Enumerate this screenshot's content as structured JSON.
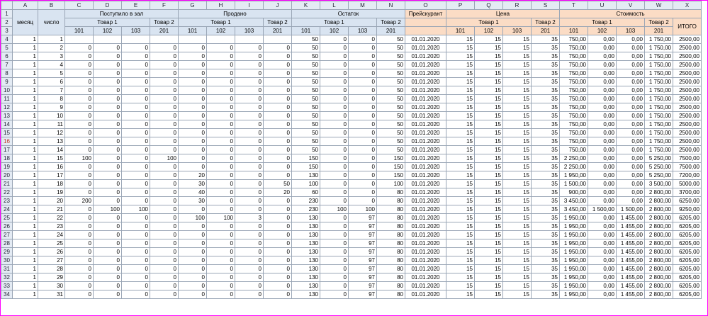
{
  "columns": [
    "A",
    "B",
    "C",
    "D",
    "E",
    "F",
    "G",
    "H",
    "I",
    "J",
    "K",
    "L",
    "M",
    "N",
    "O",
    "P",
    "Q",
    "R",
    "S",
    "T",
    "U",
    "V",
    "W",
    "X"
  ],
  "header": {
    "mesyac": "месяц",
    "chislo": "число",
    "postupilo": "Поступило в зал",
    "prodano": "Продано",
    "ostatok": "Остаток",
    "preyskurant": "Прейскурант",
    "cena": "Цена",
    "stoimost": "Стоимость",
    "tovar1": "Товар 1",
    "tovar2": "Товар 2",
    "c101": "101",
    "c102": "102",
    "c103": "103",
    "c201": "201",
    "itogo": "ИТОГО"
  },
  "selected_row_header": "16",
  "rows": [
    {
      "n": "4",
      "a": "1",
      "b": "1",
      "k": "50",
      "l": "0",
      "m": "0",
      "nn": "50",
      "o": "01.01.2020",
      "p": "15",
      "q": "15",
      "r": "15",
      "s": "35",
      "t": "750,00",
      "u": "0,00",
      "v": "0,00",
      "w": "1 750,00",
      "x": "2500,00"
    },
    {
      "n": "5",
      "a": "1",
      "b": "2",
      "c": "0",
      "d": "0",
      "e": "0",
      "f": "0",
      "g": "0",
      "h": "0",
      "i": "0",
      "j": "0",
      "k": "50",
      "l": "0",
      "m": "0",
      "nn": "50",
      "o": "01.01.2020",
      "p": "15",
      "q": "15",
      "r": "15",
      "s": "35",
      "t": "750,00",
      "u": "0,00",
      "v": "0,00",
      "w": "1 750,00",
      "x": "2500,00"
    },
    {
      "n": "6",
      "a": "1",
      "b": "3",
      "c": "0",
      "d": "0",
      "e": "0",
      "f": "0",
      "g": "0",
      "h": "0",
      "i": "0",
      "j": "0",
      "k": "50",
      "l": "0",
      "m": "0",
      "nn": "50",
      "o": "01.01.2020",
      "p": "15",
      "q": "15",
      "r": "15",
      "s": "35",
      "t": "750,00",
      "u": "0,00",
      "v": "0,00",
      "w": "1 750,00",
      "x": "2500,00"
    },
    {
      "n": "7",
      "a": "1",
      "b": "4",
      "c": "0",
      "d": "0",
      "e": "0",
      "f": "0",
      "g": "0",
      "h": "0",
      "i": "0",
      "j": "0",
      "k": "50",
      "l": "0",
      "m": "0",
      "nn": "50",
      "o": "01.01.2020",
      "p": "15",
      "q": "15",
      "r": "15",
      "s": "35",
      "t": "750,00",
      "u": "0,00",
      "v": "0,00",
      "w": "1 750,00",
      "x": "2500,00"
    },
    {
      "n": "8",
      "a": "1",
      "b": "5",
      "c": "0",
      "d": "0",
      "e": "0",
      "f": "0",
      "g": "0",
      "h": "0",
      "i": "0",
      "j": "0",
      "k": "50",
      "l": "0",
      "m": "0",
      "nn": "50",
      "o": "01.01.2020",
      "p": "15",
      "q": "15",
      "r": "15",
      "s": "35",
      "t": "750,00",
      "u": "0,00",
      "v": "0,00",
      "w": "1 750,00",
      "x": "2500,00"
    },
    {
      "n": "9",
      "a": "1",
      "b": "6",
      "c": "0",
      "d": "0",
      "e": "0",
      "f": "0",
      "g": "0",
      "h": "0",
      "i": "0",
      "j": "0",
      "k": "50",
      "l": "0",
      "m": "0",
      "nn": "50",
      "o": "01.01.2020",
      "p": "15",
      "q": "15",
      "r": "15",
      "s": "35",
      "t": "750,00",
      "u": "0,00",
      "v": "0,00",
      "w": "1 750,00",
      "x": "2500,00"
    },
    {
      "n": "10",
      "a": "1",
      "b": "7",
      "c": "0",
      "d": "0",
      "e": "0",
      "f": "0",
      "g": "0",
      "h": "0",
      "i": "0",
      "j": "0",
      "k": "50",
      "l": "0",
      "m": "0",
      "nn": "50",
      "o": "01.01.2020",
      "p": "15",
      "q": "15",
      "r": "15",
      "s": "35",
      "t": "750,00",
      "u": "0,00",
      "v": "0,00",
      "w": "1 750,00",
      "x": "2500,00"
    },
    {
      "n": "11",
      "a": "1",
      "b": "8",
      "c": "0",
      "d": "0",
      "e": "0",
      "f": "0",
      "g": "0",
      "h": "0",
      "i": "0",
      "j": "0",
      "k": "50",
      "l": "0",
      "m": "0",
      "nn": "50",
      "o": "01.01.2020",
      "p": "15",
      "q": "15",
      "r": "15",
      "s": "35",
      "t": "750,00",
      "u": "0,00",
      "v": "0,00",
      "w": "1 750,00",
      "x": "2500,00"
    },
    {
      "n": "12",
      "a": "1",
      "b": "9",
      "c": "0",
      "d": "0",
      "e": "0",
      "f": "0",
      "g": "0",
      "h": "0",
      "i": "0",
      "j": "0",
      "k": "50",
      "l": "0",
      "m": "0",
      "nn": "50",
      "o": "01.01.2020",
      "p": "15",
      "q": "15",
      "r": "15",
      "s": "35",
      "t": "750,00",
      "u": "0,00",
      "v": "0,00",
      "w": "1 750,00",
      "x": "2500,00"
    },
    {
      "n": "13",
      "a": "1",
      "b": "10",
      "c": "0",
      "d": "0",
      "e": "0",
      "f": "0",
      "g": "0",
      "h": "0",
      "i": "0",
      "j": "0",
      "k": "50",
      "l": "0",
      "m": "0",
      "nn": "50",
      "o": "01.01.2020",
      "p": "15",
      "q": "15",
      "r": "15",
      "s": "35",
      "t": "750,00",
      "u": "0,00",
      "v": "0,00",
      "w": "1 750,00",
      "x": "2500,00"
    },
    {
      "n": "14",
      "a": "1",
      "b": "11",
      "c": "0",
      "d": "0",
      "e": "0",
      "f": "0",
      "g": "0",
      "h": "0",
      "i": "0",
      "j": "0",
      "k": "50",
      "l": "0",
      "m": "0",
      "nn": "50",
      "o": "01.01.2020",
      "p": "15",
      "q": "15",
      "r": "15",
      "s": "35",
      "t": "750,00",
      "u": "0,00",
      "v": "0,00",
      "w": "1 750,00",
      "x": "2500,00"
    },
    {
      "n": "15",
      "a": "1",
      "b": "12",
      "c": "0",
      "d": "0",
      "e": "0",
      "f": "0",
      "g": "0",
      "h": "0",
      "i": "0",
      "j": "0",
      "k": "50",
      "l": "0",
      "m": "0",
      "nn": "50",
      "o": "01.01.2020",
      "p": "15",
      "q": "15",
      "r": "15",
      "s": "35",
      "t": "750,00",
      "u": "0,00",
      "v": "0,00",
      "w": "1 750,00",
      "x": "2500,00"
    },
    {
      "n": "16",
      "a": "1",
      "b": "13",
      "c": "0",
      "d": "0",
      "e": "0",
      "f": "0",
      "g": "0",
      "h": "0",
      "i": "0",
      "j": "0",
      "k": "50",
      "l": "0",
      "m": "0",
      "nn": "50",
      "o": "01.01.2020",
      "p": "15",
      "q": "15",
      "r": "15",
      "s": "35",
      "t": "750,00",
      "u": "0,00",
      "v": "0,00",
      "w": "1 750,00",
      "x": "2500,00"
    },
    {
      "n": "17",
      "a": "1",
      "b": "14",
      "c": "0",
      "d": "0",
      "e": "0",
      "f": "0",
      "g": "0",
      "h": "0",
      "i": "0",
      "j": "0",
      "k": "50",
      "l": "0",
      "m": "0",
      "nn": "50",
      "o": "01.01.2020",
      "p": "15",
      "q": "15",
      "r": "15",
      "s": "35",
      "t": "750,00",
      "u": "0,00",
      "v": "0,00",
      "w": "1 750,00",
      "x": "2500,00"
    },
    {
      "n": "18",
      "a": "1",
      "b": "15",
      "c": "100",
      "d": "0",
      "e": "0",
      "f": "100",
      "g": "0",
      "h": "0",
      "i": "0",
      "j": "0",
      "k": "150",
      "l": "0",
      "m": "0",
      "nn": "150",
      "o": "01.01.2020",
      "p": "15",
      "q": "15",
      "r": "15",
      "s": "35",
      "t": "2 250,00",
      "u": "0,00",
      "v": "0,00",
      "w": "5 250,00",
      "x": "7500,00"
    },
    {
      "n": "19",
      "a": "1",
      "b": "16",
      "c": "0",
      "d": "0",
      "e": "0",
      "f": "0",
      "g": "0",
      "h": "0",
      "i": "0",
      "j": "0",
      "k": "150",
      "l": "0",
      "m": "0",
      "nn": "150",
      "o": "01.01.2020",
      "p": "15",
      "q": "15",
      "r": "15",
      "s": "35",
      "t": "2 250,00",
      "u": "0,00",
      "v": "0,00",
      "w": "5 250,00",
      "x": "7500,00"
    },
    {
      "n": "20",
      "a": "1",
      "b": "17",
      "c": "0",
      "d": "0",
      "e": "0",
      "f": "0",
      "g": "20",
      "h": "0",
      "i": "0",
      "j": "0",
      "k": "130",
      "l": "0",
      "m": "0",
      "nn": "150",
      "o": "01.01.2020",
      "p": "15",
      "q": "15",
      "r": "15",
      "s": "35",
      "t": "1 950,00",
      "u": "0,00",
      "v": "0,00",
      "w": "5 250,00",
      "x": "7200,00"
    },
    {
      "n": "21",
      "a": "1",
      "b": "18",
      "c": "0",
      "d": "0",
      "e": "0",
      "f": "0",
      "g": "30",
      "h": "0",
      "i": "0",
      "j": "50",
      "k": "100",
      "l": "0",
      "m": "0",
      "nn": "100",
      "o": "01.01.2020",
      "p": "15",
      "q": "15",
      "r": "15",
      "s": "35",
      "t": "1 500,00",
      "u": "0,00",
      "v": "0,00",
      "w": "3 500,00",
      "x": "5000,00"
    },
    {
      "n": "22",
      "a": "1",
      "b": "19",
      "c": "0",
      "d": "0",
      "e": "0",
      "f": "0",
      "g": "40",
      "h": "0",
      "i": "0",
      "j": "20",
      "k": "60",
      "l": "0",
      "m": "0",
      "nn": "80",
      "o": "01.01.2020",
      "p": "15",
      "q": "15",
      "r": "15",
      "s": "35",
      "t": "900,00",
      "u": "0,00",
      "v": "0,00",
      "w": "2 800,00",
      "x": "3700,00"
    },
    {
      "n": "23",
      "a": "1",
      "b": "20",
      "c": "200",
      "d": "0",
      "e": "0",
      "f": "0",
      "g": "30",
      "h": "0",
      "i": "0",
      "j": "0",
      "k": "230",
      "l": "0",
      "m": "0",
      "nn": "80",
      "o": "01.01.2020",
      "p": "15",
      "q": "15",
      "r": "15",
      "s": "35",
      "t": "3 450,00",
      "u": "0,00",
      "v": "0,00",
      "w": "2 800,00",
      "x": "6250,00"
    },
    {
      "n": "24",
      "a": "1",
      "b": "21",
      "c": "0",
      "d": "100",
      "e": "100",
      "f": "0",
      "g": "0",
      "h": "0",
      "i": "0",
      "j": "0",
      "k": "230",
      "l": "100",
      "m": "100",
      "nn": "80",
      "o": "01.01.2020",
      "p": "15",
      "q": "15",
      "r": "15",
      "s": "35",
      "t": "3 450,00",
      "u": "1 500,00",
      "v": "1 500,00",
      "w": "2 800,00",
      "x": "9250,00"
    },
    {
      "n": "25",
      "a": "1",
      "b": "22",
      "c": "0",
      "d": "0",
      "e": "0",
      "f": "0",
      "g": "100",
      "h": "100",
      "i": "3",
      "j": "0",
      "k": "130",
      "l": "0",
      "m": "97",
      "nn": "80",
      "o": "01.01.2020",
      "p": "15",
      "q": "15",
      "r": "15",
      "s": "35",
      "t": "1 950,00",
      "u": "0,00",
      "v": "1 455,00",
      "w": "2 800,00",
      "x": "6205,00"
    },
    {
      "n": "26",
      "a": "1",
      "b": "23",
      "c": "0",
      "d": "0",
      "e": "0",
      "f": "0",
      "g": "0",
      "h": "0",
      "i": "0",
      "j": "0",
      "k": "130",
      "l": "0",
      "m": "97",
      "nn": "80",
      "o": "01.01.2020",
      "p": "15",
      "q": "15",
      "r": "15",
      "s": "35",
      "t": "1 950,00",
      "u": "0,00",
      "v": "1 455,00",
      "w": "2 800,00",
      "x": "6205,00"
    },
    {
      "n": "27",
      "a": "1",
      "b": "24",
      "c": "0",
      "d": "0",
      "e": "0",
      "f": "0",
      "g": "0",
      "h": "0",
      "i": "0",
      "j": "0",
      "k": "130",
      "l": "0",
      "m": "97",
      "nn": "80",
      "o": "01.01.2020",
      "p": "15",
      "q": "15",
      "r": "15",
      "s": "35",
      "t": "1 950,00",
      "u": "0,00",
      "v": "1 455,00",
      "w": "2 800,00",
      "x": "6205,00"
    },
    {
      "n": "28",
      "a": "1",
      "b": "25",
      "c": "0",
      "d": "0",
      "e": "0",
      "f": "0",
      "g": "0",
      "h": "0",
      "i": "0",
      "j": "0",
      "k": "130",
      "l": "0",
      "m": "97",
      "nn": "80",
      "o": "01.01.2020",
      "p": "15",
      "q": "15",
      "r": "15",
      "s": "35",
      "t": "1 950,00",
      "u": "0,00",
      "v": "1 455,00",
      "w": "2 800,00",
      "x": "6205,00"
    },
    {
      "n": "29",
      "a": "1",
      "b": "26",
      "c": "0",
      "d": "0",
      "e": "0",
      "f": "0",
      "g": "0",
      "h": "0",
      "i": "0",
      "j": "0",
      "k": "130",
      "l": "0",
      "m": "97",
      "nn": "80",
      "o": "01.01.2020",
      "p": "15",
      "q": "15",
      "r": "15",
      "s": "35",
      "t": "1 950,00",
      "u": "0,00",
      "v": "1 455,00",
      "w": "2 800,00",
      "x": "6205,00"
    },
    {
      "n": "30",
      "a": "1",
      "b": "27",
      "c": "0",
      "d": "0",
      "e": "0",
      "f": "0",
      "g": "0",
      "h": "0",
      "i": "0",
      "j": "0",
      "k": "130",
      "l": "0",
      "m": "97",
      "nn": "80",
      "o": "01.01.2020",
      "p": "15",
      "q": "15",
      "r": "15",
      "s": "35",
      "t": "1 950,00",
      "u": "0,00",
      "v": "1 455,00",
      "w": "2 800,00",
      "x": "6205,00"
    },
    {
      "n": "31",
      "a": "1",
      "b": "28",
      "c": "0",
      "d": "0",
      "e": "0",
      "f": "0",
      "g": "0",
      "h": "0",
      "i": "0",
      "j": "0",
      "k": "130",
      "l": "0",
      "m": "97",
      "nn": "80",
      "o": "01.01.2020",
      "p": "15",
      "q": "15",
      "r": "15",
      "s": "35",
      "t": "1 950,00",
      "u": "0,00",
      "v": "1 455,00",
      "w": "2 800,00",
      "x": "6205,00"
    },
    {
      "n": "32",
      "a": "1",
      "b": "29",
      "c": "0",
      "d": "0",
      "e": "0",
      "f": "0",
      "g": "0",
      "h": "0",
      "i": "0",
      "j": "0",
      "k": "130",
      "l": "0",
      "m": "97",
      "nn": "80",
      "o": "01.01.2020",
      "p": "15",
      "q": "15",
      "r": "15",
      "s": "35",
      "t": "1 950,00",
      "u": "0,00",
      "v": "1 455,00",
      "w": "2 800,00",
      "x": "6205,00"
    },
    {
      "n": "33",
      "a": "1",
      "b": "30",
      "c": "0",
      "d": "0",
      "e": "0",
      "f": "0",
      "g": "0",
      "h": "0",
      "i": "0",
      "j": "0",
      "k": "130",
      "l": "0",
      "m": "97",
      "nn": "80",
      "o": "01.01.2020",
      "p": "15",
      "q": "15",
      "r": "15",
      "s": "35",
      "t": "1 950,00",
      "u": "0,00",
      "v": "1 455,00",
      "w": "2 800,00",
      "x": "6205,00"
    },
    {
      "n": "34",
      "a": "1",
      "b": "31",
      "c": "0",
      "d": "0",
      "e": "0",
      "f": "0",
      "g": "0",
      "h": "0",
      "i": "0",
      "j": "0",
      "k": "130",
      "l": "0",
      "m": "97",
      "nn": "80",
      "o": "01.01.2020",
      "p": "15",
      "q": "15",
      "r": "15",
      "s": "35",
      "t": "1 950,00",
      "u": "0,00",
      "v": "1 455,00",
      "w": "2 800,00",
      "x": "6205,00"
    }
  ]
}
